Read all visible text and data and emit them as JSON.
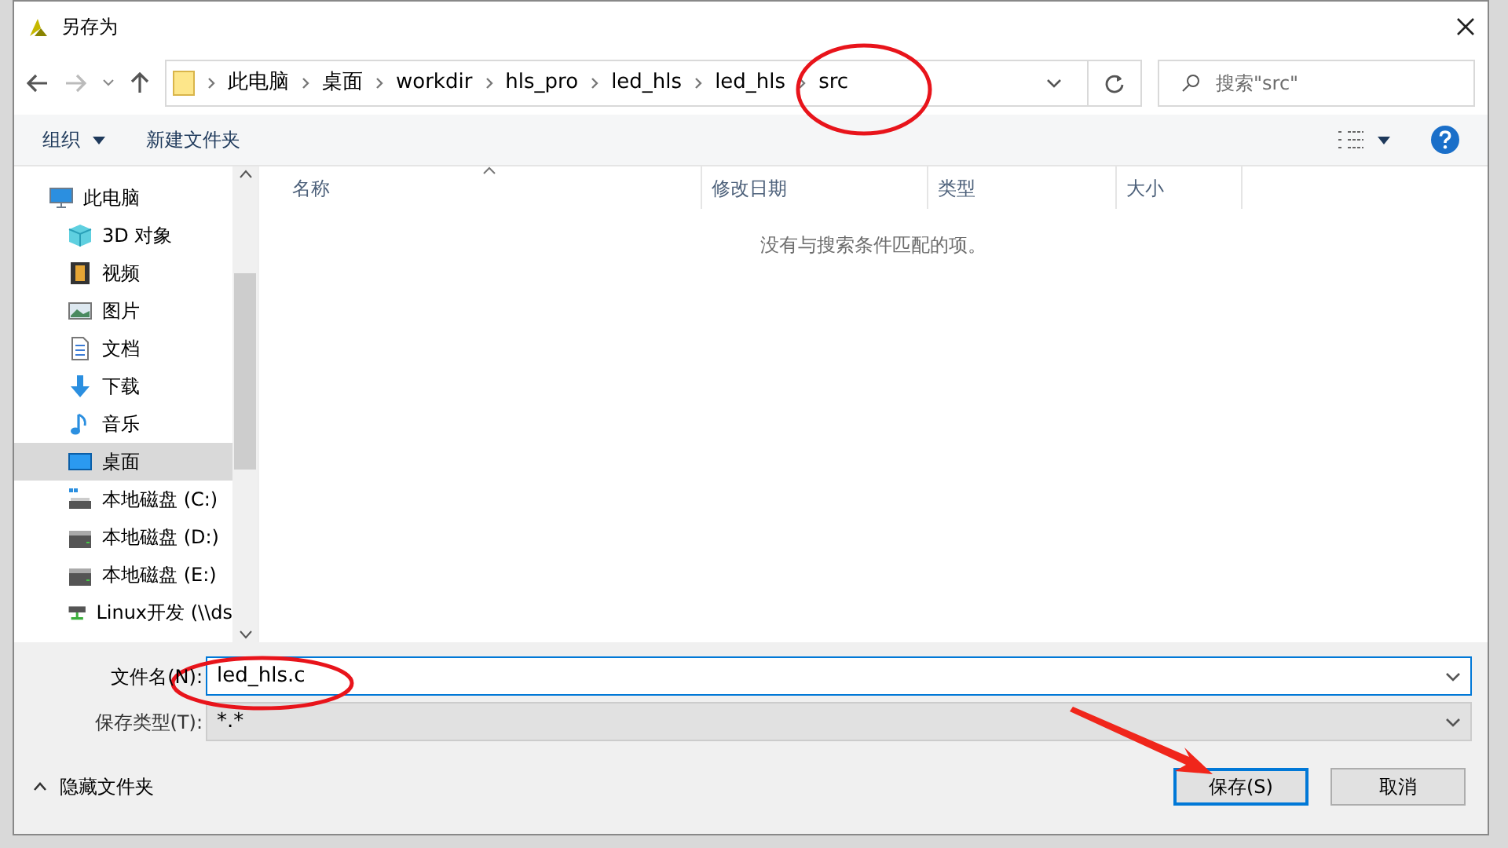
{
  "window": {
    "title": "另存为"
  },
  "breadcrumb": [
    "此电脑",
    "桌面",
    "workdir",
    "hls_pro",
    "led_hls",
    "led_hls",
    "src"
  ],
  "search": {
    "placeholder": "搜索\"src\""
  },
  "toolbar": {
    "organize": "组织",
    "new_folder": "新建文件夹"
  },
  "sidebar": {
    "items": [
      {
        "label": "此电脑",
        "kind": "pc",
        "selected": false,
        "children": [
          {
            "label": "3D 对象",
            "kind": "cube",
            "selected": false
          },
          {
            "label": "视频",
            "kind": "film",
            "selected": false
          },
          {
            "label": "图片",
            "kind": "picture",
            "selected": false
          },
          {
            "label": "文档",
            "kind": "document",
            "selected": false
          },
          {
            "label": "下载",
            "kind": "download",
            "selected": false
          },
          {
            "label": "音乐",
            "kind": "music",
            "selected": false
          },
          {
            "label": "桌面",
            "kind": "desktop",
            "selected": true
          },
          {
            "label": "本地磁盘 (C:)",
            "kind": "system-drive",
            "selected": false
          },
          {
            "label": "本地磁盘 (D:)",
            "kind": "drive",
            "selected": false
          },
          {
            "label": "本地磁盘 (E:)",
            "kind": "drive",
            "selected": false
          },
          {
            "label": "Linux开发 (\\\\ds",
            "kind": "network-drive",
            "selected": false
          }
        ]
      }
    ]
  },
  "table": {
    "columns": [
      {
        "label": "名称",
        "sorted": true
      },
      {
        "label": "修改日期",
        "sorted": false
      },
      {
        "label": "类型",
        "sorted": false
      },
      {
        "label": "大小",
        "sorted": false
      }
    ],
    "empty_message": "没有与搜索条件匹配的项。"
  },
  "form": {
    "file_name_label": "文件名(N):",
    "file_name": "led_hls.c",
    "type_label": "保存类型(T):",
    "type_value": "*.*"
  },
  "footer": {
    "hide_folders": "隐藏文件夹",
    "buttons": [
      {
        "label": "保存(S)",
        "default": true
      },
      {
        "label": "取消",
        "default": false
      }
    ]
  }
}
